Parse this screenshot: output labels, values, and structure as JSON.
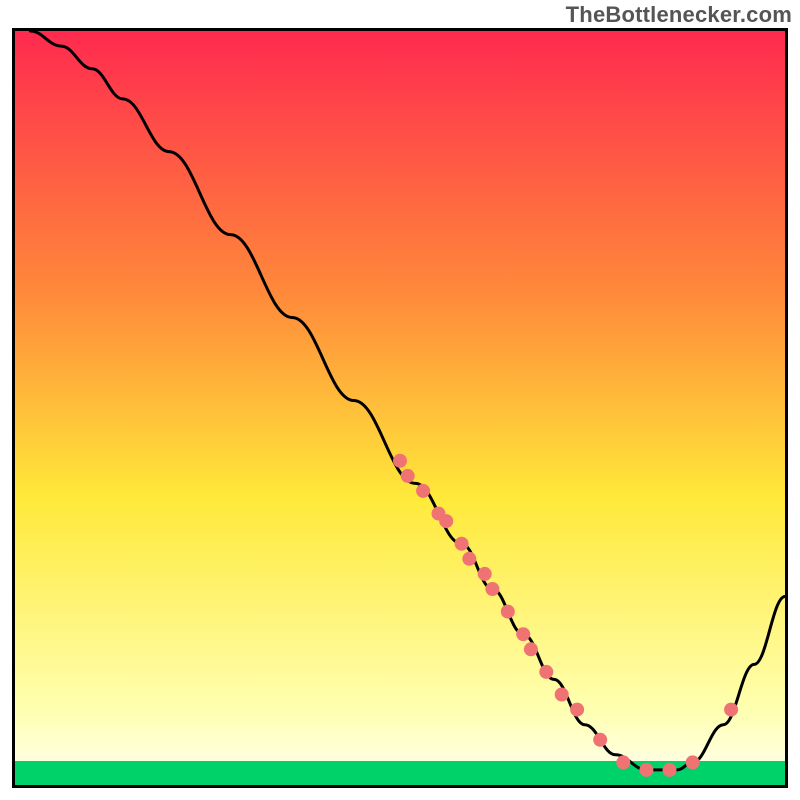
{
  "watermark": "TheBottlenecker.com",
  "chart_data": {
    "type": "line",
    "title": "",
    "xlabel": "",
    "ylabel": "",
    "xlim": [
      0,
      100
    ],
    "ylim": [
      0,
      100
    ],
    "gradient_colors": {
      "top": "#ff2a4f",
      "mid1": "#ff8a3a",
      "mid2": "#ffe93a",
      "mid3": "#ffffb0",
      "bottom_band": "#00d26a"
    },
    "series": [
      {
        "name": "bottleneck-curve",
        "stroke": "#000000",
        "x": [
          2,
          6,
          10,
          14,
          20,
          28,
          36,
          44,
          52,
          58,
          62,
          66,
          70,
          74,
          78,
          82,
          86,
          88,
          92,
          96,
          100
        ],
        "values": [
          100,
          98,
          95,
          91,
          84,
          73,
          62,
          51,
          40,
          32,
          26,
          20,
          14,
          8,
          4,
          2,
          2,
          3,
          8,
          16,
          25
        ]
      }
    ],
    "markers": {
      "name": "curve-markers",
      "color": "#f07373",
      "radius": 7,
      "points": [
        {
          "x": 50,
          "y": 43
        },
        {
          "x": 51,
          "y": 41
        },
        {
          "x": 53,
          "y": 39
        },
        {
          "x": 55,
          "y": 36
        },
        {
          "x": 56,
          "y": 35
        },
        {
          "x": 58,
          "y": 32
        },
        {
          "x": 59,
          "y": 30
        },
        {
          "x": 61,
          "y": 28
        },
        {
          "x": 62,
          "y": 26
        },
        {
          "x": 64,
          "y": 23
        },
        {
          "x": 66,
          "y": 20
        },
        {
          "x": 67,
          "y": 18
        },
        {
          "x": 69,
          "y": 15
        },
        {
          "x": 71,
          "y": 12
        },
        {
          "x": 73,
          "y": 10
        },
        {
          "x": 76,
          "y": 6
        },
        {
          "x": 79,
          "y": 3
        },
        {
          "x": 82,
          "y": 2
        },
        {
          "x": 85,
          "y": 2
        },
        {
          "x": 88,
          "y": 3
        },
        {
          "x": 93,
          "y": 10
        }
      ]
    }
  }
}
